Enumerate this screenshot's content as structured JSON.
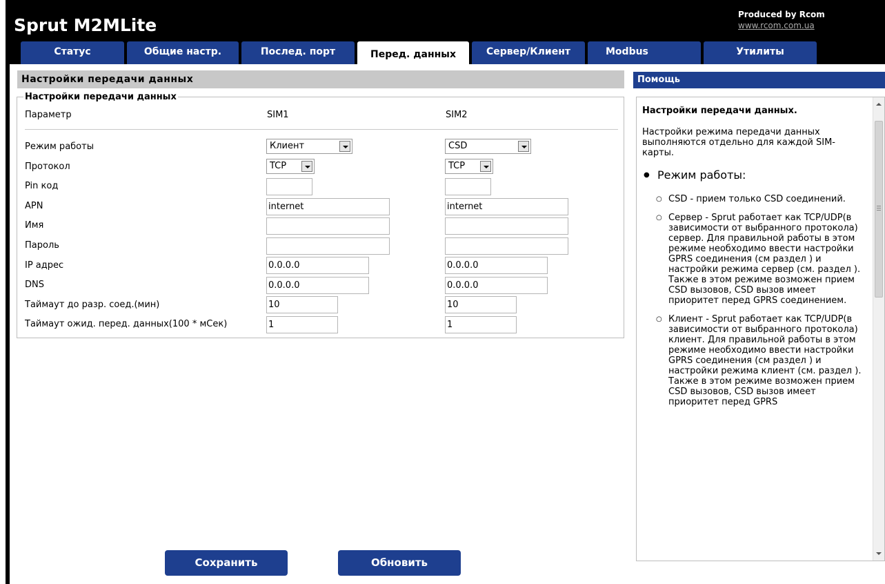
{
  "app": {
    "title": "Sprut M2MLite",
    "produced_by": "Produced by Rcom",
    "produced_link": "www.rcom.com.ua"
  },
  "tabs": [
    {
      "label": "Статус",
      "active": false
    },
    {
      "label": "Общие настр.",
      "active": false
    },
    {
      "label": "Послед. порт",
      "active": false
    },
    {
      "label": "Перед. данных",
      "active": true
    },
    {
      "label": "Сервер/Клиент",
      "active": false
    },
    {
      "label": "Modbus",
      "active": false
    },
    {
      "label": "Утилиты",
      "active": false
    }
  ],
  "main": {
    "section_title": "Настройки передачи данных",
    "legend": "Настройки передачи данных",
    "col_param": "Параметр",
    "col_sim1": "SIM1",
    "col_sim2": "SIM2",
    "rows": {
      "mode": "Режим работы",
      "protocol": "Протокол",
      "pin": "Pin код",
      "apn": "APN",
      "name": "Имя",
      "password": "Пароль",
      "ip": "IP адрес",
      "dns": "DNS",
      "timeout_disconnect": "Таймаут до разр. соед.(мин)",
      "timeout_wait": "Таймаут ожид. перед. данных(100 * мСек)"
    },
    "sim1": {
      "mode": "Клиент",
      "protocol": "TCP",
      "pin": "",
      "apn": "internet",
      "name": "",
      "password": "",
      "ip": "0.0.0.0",
      "dns": "0.0.0.0",
      "timeout_disconnect": "10",
      "timeout_wait": "1"
    },
    "sim2": {
      "mode": "CSD",
      "protocol": "TCP",
      "pin": "",
      "apn": "internet",
      "name": "",
      "password": "",
      "ip": "0.0.0.0",
      "dns": "0.0.0.0",
      "timeout_disconnect": "10",
      "timeout_wait": "1"
    },
    "save_label": "Сохранить",
    "refresh_label": "Обновить"
  },
  "help": {
    "header": "Помощь",
    "title": "Настройки передачи данных.",
    "intro": "Настройки режима передачи данных выполняются отдельно для каждой SIM-карты.",
    "bullet": "Режим работы:",
    "items": [
      "CSD - прием только CSD соединений.",
      "Сервер - Sprut работает как TCP/UDP(в зависимости от выбранного протокола) сервер. Для правильной работы в этом режиме необходимо ввести настройки GPRS соединения (см раздел ) и настройки режима сервер (см. раздел ). Также в этом режиме возможен прием CSD вызовов, CSD вызов имеет приоритет перед GPRS соединением.",
      "Клиент - Sprut работает как TCP/UDP(в зависимости от выбранного протокола) клиент. Для правильной работы в этом режиме необходимо ввести настройки GPRS соединения (см раздел ) и настройки режима клиент (см. раздел ). Также в этом режиме возможен прием CSD вызовов, CSD вызов имеет приоритет перед GPRS"
    ]
  }
}
